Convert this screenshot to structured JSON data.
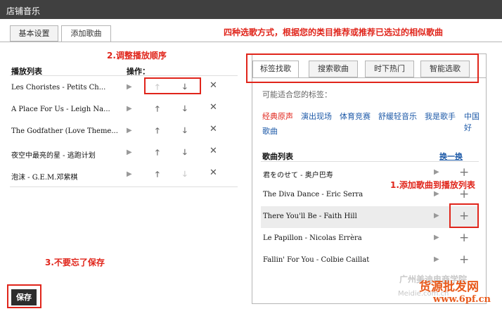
{
  "window": {
    "title": "店铺音乐"
  },
  "tabs": [
    "基本设置",
    "添加歌曲"
  ],
  "annotations": {
    "top": "四种选歌方式，根据您的类目推荐或推荐已选过的相似歌曲",
    "reorder": "2.调整播放顺序",
    "add": "1.添加歌曲到播放列表",
    "save": "3.不要忘了保存"
  },
  "playlist": {
    "header": "播放列表",
    "ops_header": "操作：",
    "items": [
      {
        "title": "Les Choristes - Petits Ch..."
      },
      {
        "title": "A Place For Us - Leigh Na..."
      },
      {
        "title": "The Godfather (Love Theme..."
      },
      {
        "title": "夜空中最亮的星 - 逃跑计划"
      },
      {
        "title": "泡沫 - G.E.M.邓紫棋"
      }
    ]
  },
  "search_tabs": [
    "标签找歌",
    "搜索歌曲",
    "时下热门",
    "智能选歌"
  ],
  "tags": {
    "hint": "可能适合您的标签：",
    "items": [
      "经典原声",
      "演出现场",
      "体育竞赛",
      "舒缓轻音乐",
      "我是歌手",
      "中国好",
      "歌曲"
    ]
  },
  "songs": {
    "header": "歌曲列表",
    "refresh": "换一换",
    "items": [
      {
        "title": "君をのせて - 奥户巴寿"
      },
      {
        "title": "The Diva Dance - Eric Serra"
      },
      {
        "title": "There You'll Be  - Faith Hill"
      },
      {
        "title": "Le Papillon  - Nicolas Errèra"
      },
      {
        "title": "Fallin' For You - Colbie Caillat"
      }
    ]
  },
  "save_label": "保存",
  "watermark": {
    "line1": "广州美迪电商学院",
    "line2": "Meidie.com.cn",
    "brand": "货源批发网",
    "url": "www.6pf.cn"
  },
  "colors": {
    "annotation_red": "#e0251b",
    "tag_blue": "#1e5aa8",
    "titlebar": "#404040"
  }
}
